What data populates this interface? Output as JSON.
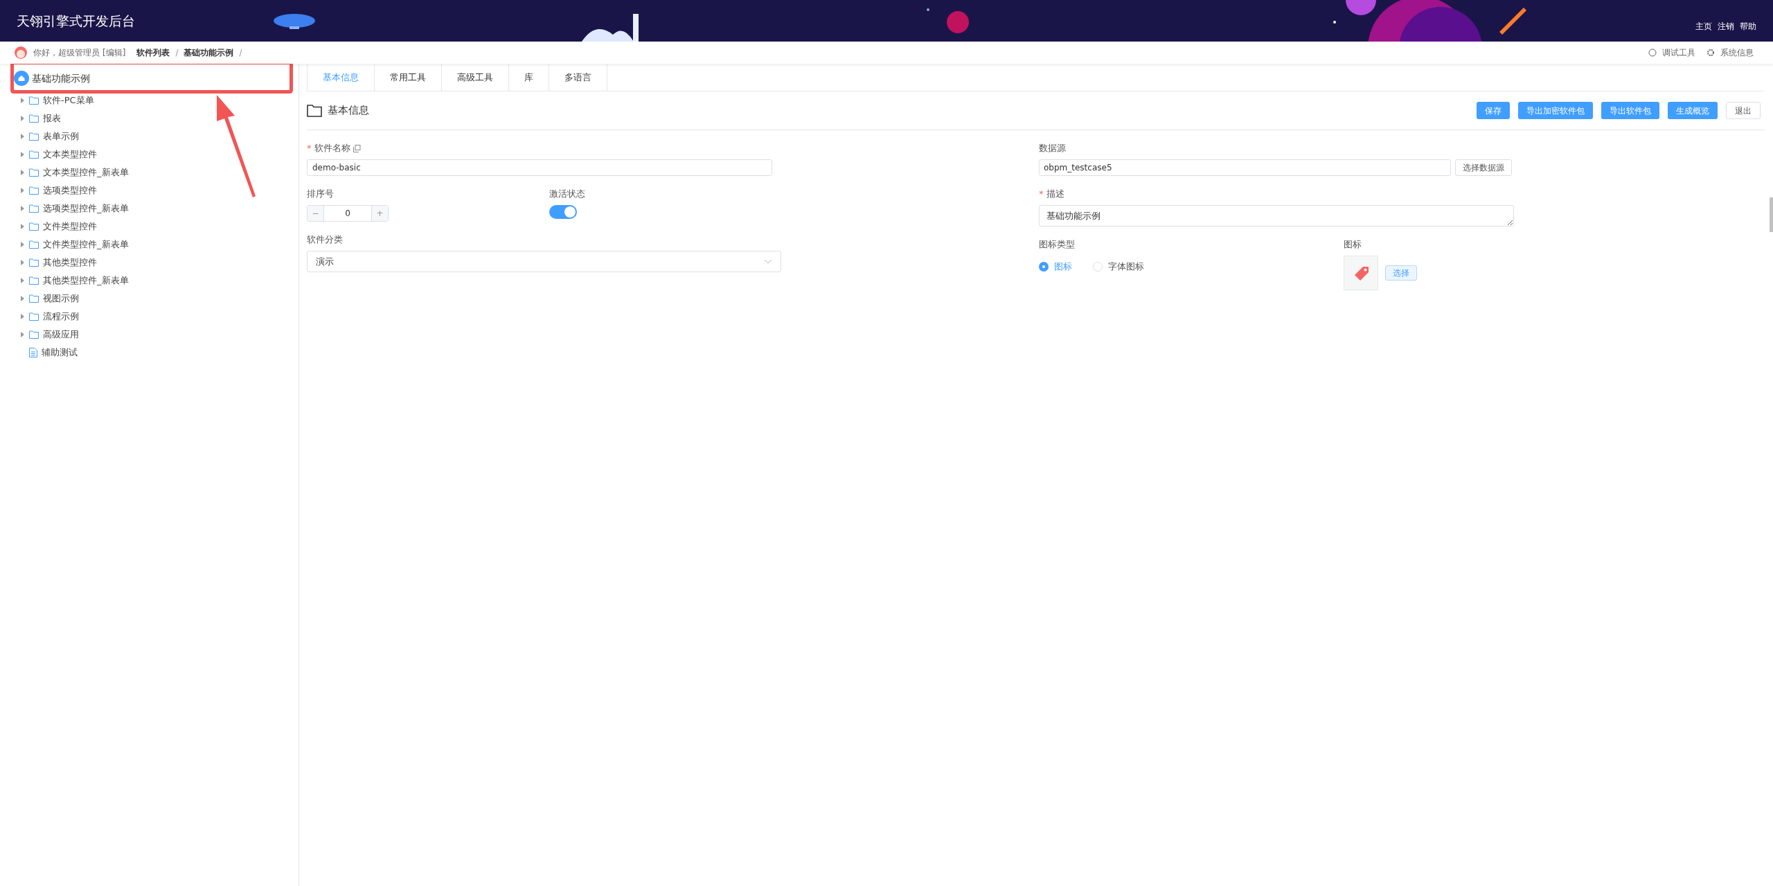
{
  "header": {
    "title": "天翎引擎式开发后台",
    "links": [
      "主页",
      "注销",
      "帮助"
    ]
  },
  "breadcrumb": {
    "greeting": "你好，超级管理员",
    "edit": "[编辑]",
    "items": [
      "软件列表",
      "基础功能示例"
    ],
    "separator": "/",
    "tools": [
      "调试工具",
      "系统信息"
    ]
  },
  "sidebar": {
    "root": "基础功能示例",
    "items": [
      {
        "label": "软件-PC菜单",
        "kind": "folder",
        "expanded": false
      },
      {
        "label": "报表",
        "kind": "folder",
        "expanded": false
      },
      {
        "label": "表单示例",
        "kind": "folder",
        "expanded": false
      },
      {
        "label": "文本类型控件",
        "kind": "folder",
        "expanded": false
      },
      {
        "label": "文本类型控件_新表单",
        "kind": "folder",
        "expanded": false
      },
      {
        "label": "选项类型控件",
        "kind": "folder",
        "expanded": false
      },
      {
        "label": "选项类型控件_新表单",
        "kind": "folder",
        "expanded": false
      },
      {
        "label": "文件类型控件",
        "kind": "folder",
        "expanded": false
      },
      {
        "label": "文件类型控件_新表单",
        "kind": "folder",
        "expanded": false
      },
      {
        "label": "其他类型控件",
        "kind": "folder",
        "expanded": false
      },
      {
        "label": "其他类型控件_新表单",
        "kind": "folder",
        "expanded": false
      },
      {
        "label": "视图示例",
        "kind": "folder",
        "expanded": false
      },
      {
        "label": "流程示例",
        "kind": "folder",
        "expanded": false
      },
      {
        "label": "高级应用",
        "kind": "folder",
        "expanded": false
      },
      {
        "label": "辅助测试",
        "kind": "file"
      }
    ]
  },
  "tabs": [
    {
      "label": "基本信息",
      "selected": true
    },
    {
      "label": "常用工具",
      "selected": false
    },
    {
      "label": "高级工具",
      "selected": false
    },
    {
      "label": "库",
      "selected": false
    },
    {
      "label": "多语言",
      "selected": false
    }
  ],
  "section": {
    "title": "基本信息",
    "buttons": [
      {
        "label": "保存",
        "kind": "primary"
      },
      {
        "label": "导出加密软件包",
        "kind": "primary"
      },
      {
        "label": "导出软件包",
        "kind": "primary"
      },
      {
        "label": "生成概览",
        "kind": "primary"
      },
      {
        "label": "退出",
        "kind": "plain"
      }
    ]
  },
  "form": {
    "required_mark": "*",
    "name": {
      "label": "软件名称",
      "required": true,
      "value": "demo-basic"
    },
    "order": {
      "label": "排序号",
      "value": "0",
      "minus": "−",
      "plus": "+"
    },
    "active": {
      "label": "激活状态",
      "on": true
    },
    "category": {
      "label": "软件分类",
      "value": "演示"
    },
    "datasource": {
      "label": "数据源",
      "value": "obpm_testcase5",
      "button": "选择数据源"
    },
    "description": {
      "label": "描述",
      "required": true,
      "value": "基础功能示例"
    },
    "icon_type": {
      "label": "图标类型",
      "options": [
        {
          "label": "图标",
          "selected": true
        },
        {
          "label": "字体图标",
          "selected": false
        }
      ]
    },
    "icon": {
      "label": "图标",
      "button": "选择"
    }
  }
}
